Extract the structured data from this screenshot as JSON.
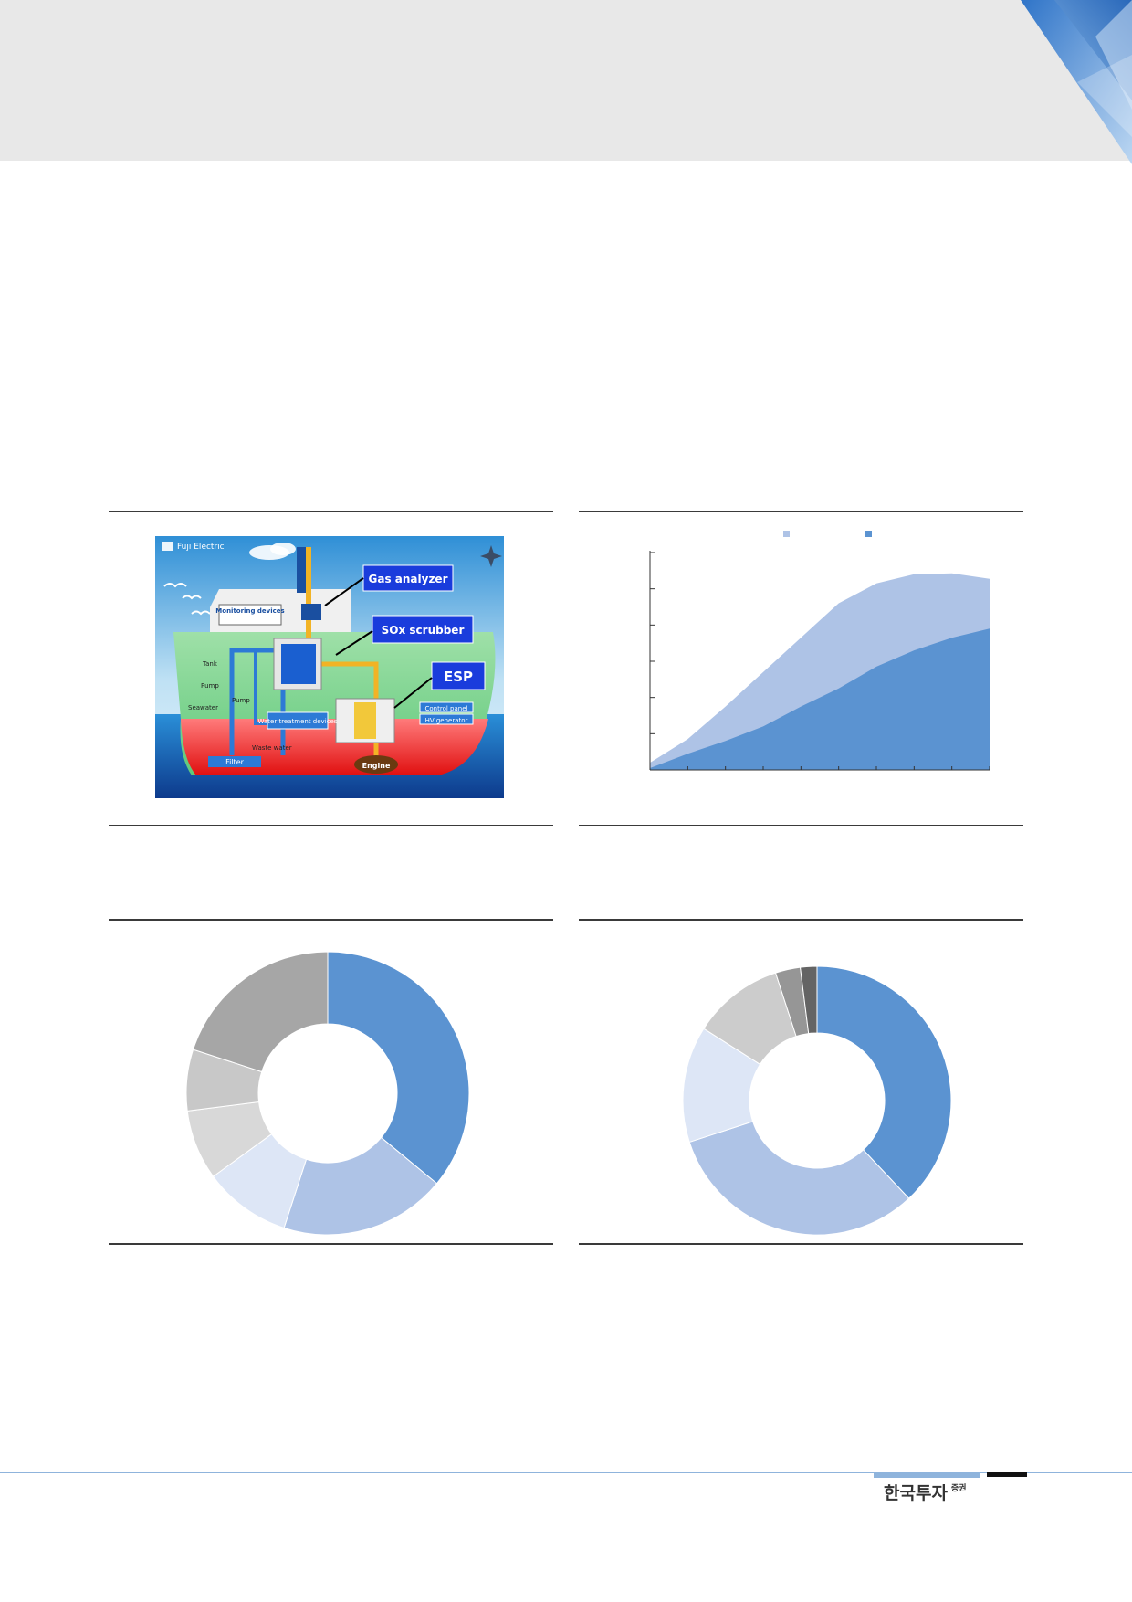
{
  "diagram": {
    "brand": "Fuji Electric",
    "labels": {
      "gas_analyzer": "Gas analyzer",
      "sox_scrubber": "SOx scrubber",
      "esp": "ESP",
      "monitoring": "Monitoring devices",
      "tank": "Tank",
      "pump1": "Pump",
      "pump2": "Pump",
      "seawater": "Seawater",
      "water_treatment": "Water treatment devices",
      "waste_water": "Waste water",
      "filter": "Filter",
      "control_panel": "Control panel",
      "hv_generator": "HV generator",
      "engine": "Engine"
    }
  },
  "footer": {
    "brand": "한국투자",
    "brand_sup": "증권"
  },
  "colors": {
    "dark_blue": "#5b93d1",
    "light_blue": "#aec3e6",
    "lighter_blue": "#dde6f6",
    "grey_dark": "#a6a6a6",
    "grey_light": "#d8d8d8"
  },
  "chart_data": [
    {
      "type": "area",
      "x": [
        0,
        1,
        2,
        3,
        4,
        5,
        6,
        7,
        8,
        9
      ],
      "series": [
        {
          "color": "#aec3e6",
          "values": [
            0.4,
            1.7,
            3.5,
            5.4,
            7.3,
            9.2,
            10.3,
            10.8,
            10.85,
            10.55
          ]
        },
        {
          "color": "#5b93d1",
          "values": [
            0.1,
            0.9,
            1.6,
            2.4,
            3.5,
            4.5,
            5.7,
            6.6,
            7.3,
            7.8
          ]
        }
      ],
      "ylim": [
        0,
        12
      ],
      "legend": "top"
    },
    {
      "type": "pie",
      "style": "donut",
      "values": [
        36,
        19,
        10,
        8,
        7,
        20
      ],
      "colors": [
        "#5b93d1",
        "#aec3e6",
        "#dde6f6",
        "#d8d8d8",
        "#c8c8c8",
        "#a6a6a6"
      ]
    },
    {
      "type": "pie",
      "style": "donut",
      "values": [
        38,
        32,
        14,
        11,
        3,
        2
      ],
      "colors": [
        "#5b93d1",
        "#aec3e6",
        "#dde6f6",
        "#cccccc",
        "#969696",
        "#646464"
      ]
    }
  ]
}
